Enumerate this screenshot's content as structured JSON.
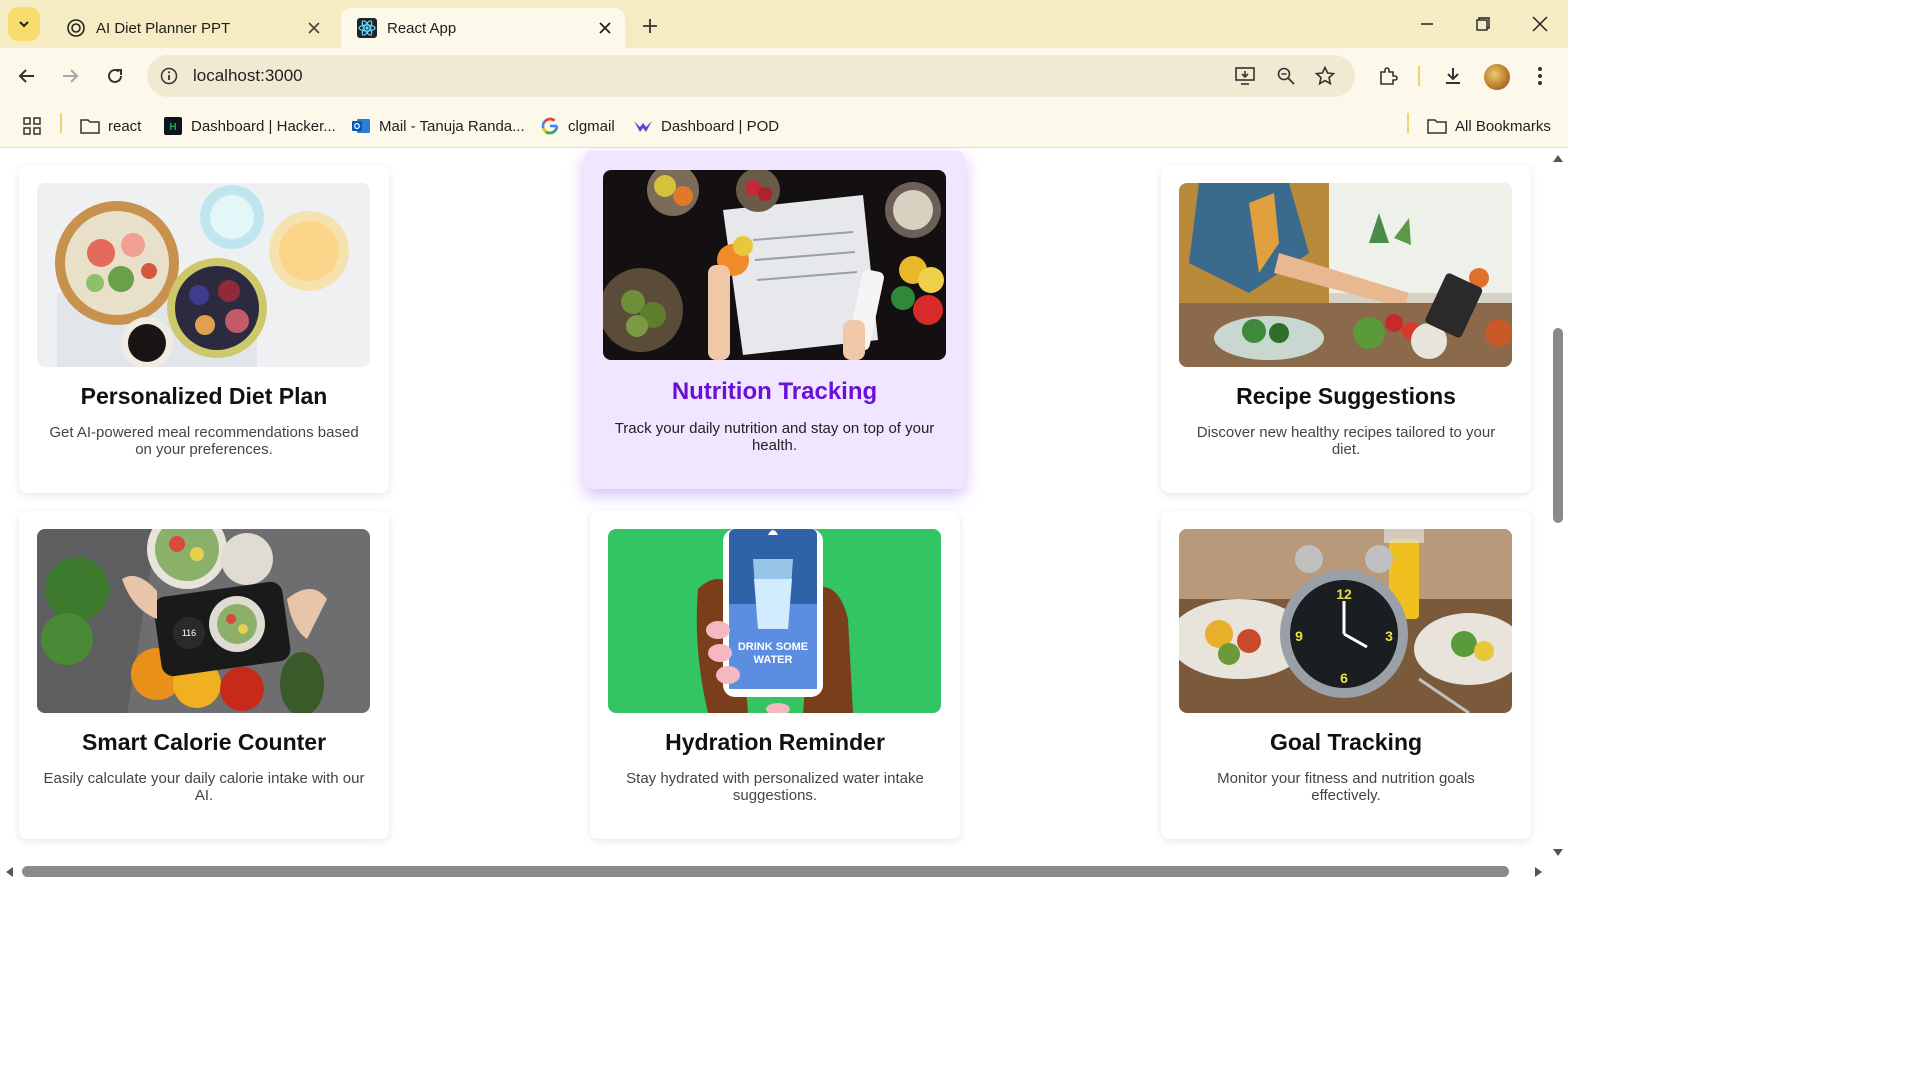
{
  "browser": {
    "tabs": [
      {
        "title": "AI Diet Planner PPT",
        "active": false
      },
      {
        "title": "React App",
        "active": true
      }
    ],
    "url": "localhost:3000",
    "bookmarks": [
      {
        "label": "react"
      },
      {
        "label": "Dashboard | Hacker..."
      },
      {
        "label": "Mail - Tanuja Randa..."
      },
      {
        "label": "clgmail"
      },
      {
        "label": "Dashboard | POD"
      }
    ],
    "all_bookmarks_label": "All Bookmarks"
  },
  "features": [
    {
      "title": "Personalized Diet Plan",
      "description": "Get AI-powered meal recommendations based on your preferences."
    },
    {
      "title": "Nutrition Tracking",
      "description": "Track your daily nutrition and stay on top of your health."
    },
    {
      "title": "Recipe Suggestions",
      "description": "Discover new healthy recipes tailored to your diet."
    },
    {
      "title": "Smart Calorie Counter",
      "description": "Easily calculate your daily calorie intake with our AI."
    },
    {
      "title": "Hydration Reminder",
      "description": "Stay hydrated with personalized water intake suggestions."
    },
    {
      "title": "Goal Tracking",
      "description": "Monitor your fitness and nutrition goals effectively."
    }
  ],
  "image_text": {
    "calorie_number": "116",
    "water_label_1": "DRINK SOME",
    "water_label_2": "WATER"
  },
  "colors": {
    "accent_hover": "#6a10d8",
    "hover_card_bg": "#f1e6ff",
    "chrome_bg": "#f5ecc3",
    "hydration_green": "#33c463"
  }
}
